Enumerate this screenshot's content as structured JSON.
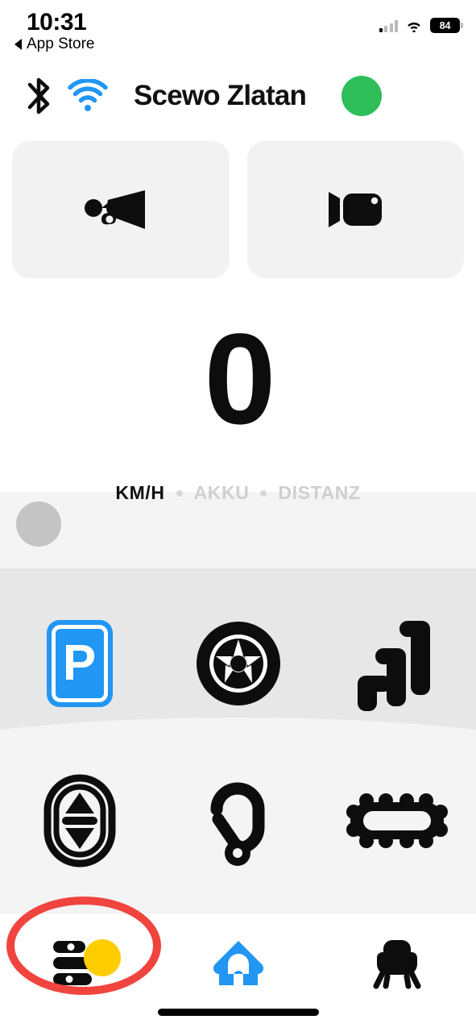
{
  "status_bar": {
    "time": "10:31",
    "back_label": "App Store",
    "back_icon": "back-triangle-icon",
    "signal_icon": "cellular-signal-icon",
    "wifi_icon": "wifi-icon",
    "battery_level": "84"
  },
  "device_header": {
    "bluetooth_icon": "bluetooth-icon",
    "wifi_icon": "wifi-icon",
    "device_name": "Scewo Zlatan",
    "connection_status_icon": "status-dot",
    "connection_status_color": "#2ebd59",
    "wifi_color": "#2196f3"
  },
  "quick_actions": [
    {
      "name": "horn-button",
      "icon": "horn-icon",
      "label": "Horn"
    },
    {
      "name": "camera-button",
      "icon": "video-camera-icon",
      "label": "Camera"
    }
  ],
  "speed_display": {
    "value": "0",
    "tabs": [
      {
        "label": "KM/H",
        "active": true
      },
      {
        "label": "AKKU",
        "active": false
      },
      {
        "label": "DISTANZ",
        "active": false
      }
    ]
  },
  "slider": {
    "name": "speed-slider",
    "knob_position": "left",
    "knob_color": "#c4c4c4",
    "track_color": "#f4f4f4"
  },
  "controls": {
    "row1": [
      {
        "name": "parking-mode-button",
        "icon": "parking-p-icon",
        "active": true,
        "color": "#2196f3"
      },
      {
        "name": "wheel-mode-button",
        "icon": "wheel-icon",
        "active": false,
        "color": "#0d0d0d"
      },
      {
        "name": "stairs-mode-button",
        "icon": "stairs-icon",
        "active": false,
        "color": "#0d0d0d"
      }
    ],
    "row2": [
      {
        "name": "lift-height-button",
        "icon": "up-down-arrows-oval-icon",
        "active": false,
        "color": "#0d0d0d"
      },
      {
        "name": "hook-button",
        "icon": "carabiner-hook-icon",
        "active": false,
        "color": "#0d0d0d"
      },
      {
        "name": "track-mode-button",
        "icon": "caterpillar-track-icon",
        "active": false,
        "color": "#0d0d0d"
      }
    ]
  },
  "bottom_nav": [
    {
      "name": "nav-settings",
      "icon": "sliders-settings-icon",
      "active": false,
      "badge": true,
      "badge_color": "#ffcc00",
      "color": "#0d0d0d"
    },
    {
      "name": "nav-home",
      "icon": "house-icon",
      "active": true,
      "badge": false,
      "color": "#2196f3"
    },
    {
      "name": "nav-seat",
      "icon": "seat-icon",
      "active": false,
      "badge": false,
      "color": "#0d0d0d"
    }
  ],
  "annotation": {
    "name": "red-highlight-circle",
    "target": "nav-settings",
    "color": "#f0443f"
  }
}
